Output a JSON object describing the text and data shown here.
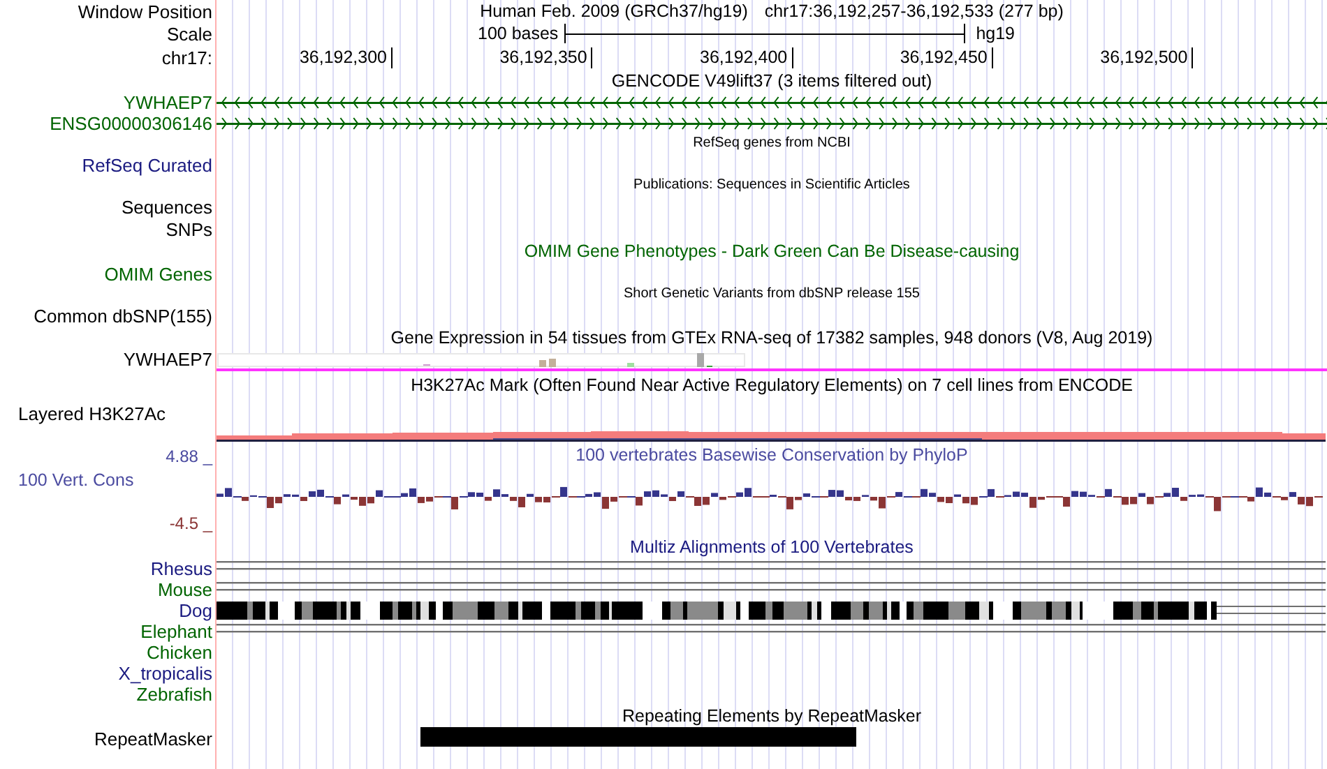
{
  "header": {
    "labels": [
      "Window Position",
      "Scale",
      "chr17:"
    ],
    "assembly_title": "Human Feb. 2009 (GRCh37/hg19)",
    "position": "chr17:36,192,257-36,192,533 (277 bp)",
    "scale_text": "100 bases",
    "assembly": "hg19",
    "ticks": [
      "36,192,300",
      "36,192,350",
      "36,192,400",
      "36,192,450",
      "36,192,500"
    ]
  },
  "rows": [
    {
      "kind": "title",
      "text": "GENCODE V49lift37 (3 items filtered out)",
      "color": "#000000"
    },
    {
      "kind": "reverse_gene",
      "label": "YWHAEP7",
      "color": "#006400"
    },
    {
      "kind": "forward_gene",
      "label": "ENSG00000306146",
      "color": "#006400"
    },
    {
      "kind": "note",
      "text": "RefSeq genes from NCBI"
    },
    {
      "kind": "label",
      "label": "RefSeq Curated",
      "color": "#1a1a80"
    },
    {
      "kind": "note",
      "text": "Publications: Sequences in Scientific Articles"
    },
    {
      "kind": "label",
      "label": "Sequences",
      "color": "#000000"
    },
    {
      "kind": "label",
      "label": "SNPs",
      "color": "#000000"
    },
    {
      "kind": "title",
      "text": "OMIM Gene Phenotypes - Dark Green Can Be Disease-causing",
      "color": "#006400"
    },
    {
      "kind": "label",
      "label": "OMIM Genes",
      "color": "#006400"
    },
    {
      "kind": "note",
      "text": "Short Genetic Variants from dbSNP release 155"
    },
    {
      "kind": "label",
      "label": "Common dbSNP(155)",
      "color": "#000000"
    },
    {
      "kind": "title",
      "text": "Gene Expression in 54 tissues from GTEx RNA-seq of 17382 samples, 948 donors (V8, Aug 2019)",
      "color": "#000000"
    },
    {
      "kind": "expression",
      "label": "YWHAEP7",
      "color": "#000000"
    },
    {
      "kind": "title",
      "text": "H3K27Ac Mark (Often Found Near Active Regulatory Elements) on 7 cell lines from ENCODE",
      "color": "#000000"
    },
    {
      "kind": "layered",
      "label": "Layered H3K27Ac",
      "color": "#000000"
    },
    {
      "kind": "conservation",
      "label": "100 Vert. Cons",
      "max": "4.88 _",
      "min": "-4.5 _",
      "title": "100 vertebrates Basewise Conservation by PhyloP"
    },
    {
      "kind": "title",
      "text": "Multiz Alignments of 100 Vertebrates",
      "color": "#1a1a80"
    },
    {
      "kind": "species_lines",
      "label": "Rhesus",
      "color": "#1a1a80"
    },
    {
      "kind": "species_lines",
      "label": "Mouse",
      "color": "#006400"
    },
    {
      "kind": "species_blocks",
      "label": "Dog",
      "color": "#1a1a80"
    },
    {
      "kind": "species_lines",
      "label": "Elephant",
      "color": "#006400"
    },
    {
      "kind": "species_empty",
      "label": "Chicken",
      "color": "#006400"
    },
    {
      "kind": "species_empty",
      "label": "X_tropicalis",
      "color": "#1a1a80"
    },
    {
      "kind": "species_empty",
      "label": "Zebrafish",
      "color": "#006400"
    },
    {
      "kind": "title",
      "text": "Repeating Elements by RepeatMasker",
      "color": "#000000"
    },
    {
      "kind": "repeat",
      "label": "RepeatMasker",
      "color": "#000000"
    }
  ]
}
